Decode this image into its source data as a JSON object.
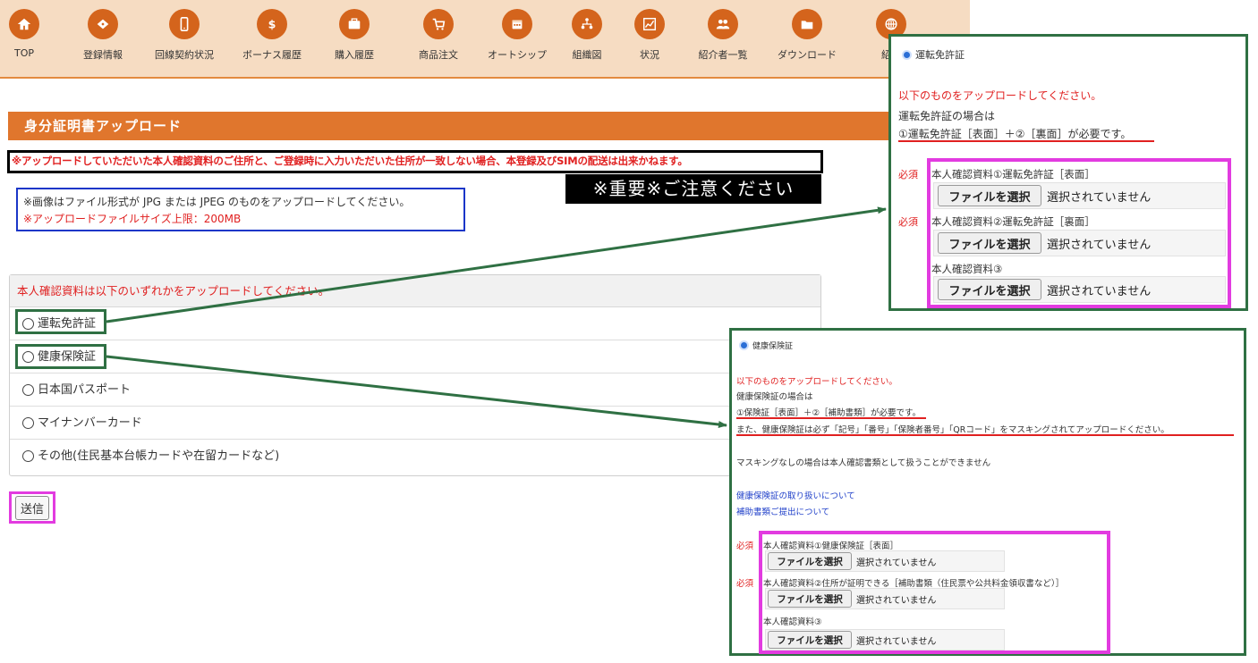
{
  "nav": {
    "items": [
      {
        "label": "TOP",
        "icon": "home-icon"
      },
      {
        "label": "登録情報",
        "icon": "tag-icon"
      },
      {
        "label": "回線契約状況",
        "icon": "phone-icon"
      },
      {
        "label": "ボーナス履歴",
        "icon": "dollar-icon"
      },
      {
        "label": "購入履歴",
        "icon": "briefcase-icon"
      },
      {
        "label": "商品注文",
        "icon": "cart-icon"
      },
      {
        "label": "オートシップ",
        "icon": "calendar-icon"
      },
      {
        "label": "組織図",
        "icon": "org-chart-icon"
      },
      {
        "label": "状況",
        "icon": "chart-icon"
      },
      {
        "label": "紹介者一覧",
        "icon": "users-icon"
      },
      {
        "label": "ダウンロード",
        "icon": "folder-icon"
      },
      {
        "label": "紹介",
        "icon": "globe-icon"
      }
    ]
  },
  "page": {
    "title": "身分証明書アップロード",
    "warning": "※アップロードしていただいた本人確認資料のご住所と、ご登録時に入力いただいた住所が一致しない場合、本登録及びSIMの配送は出来かねます。",
    "important": "※重要※ご注意ください",
    "info_format": "※画像はファイル形式が JPG または JPEG のものをアップロードしてください。",
    "info_size": "※アップロードファイルサイズ上限：200MB"
  },
  "selection": {
    "header": "本人確認資料は以下のいずれかをアップロードしてください。",
    "options": [
      "運転免許証",
      "健康保険証",
      "日本国パスポート",
      "マイナンバーカード",
      "その他(住民基本台帳カードや在留カードなど)"
    ]
  },
  "submit_label": "送信",
  "license_panel": {
    "radio_label": "運転免許証",
    "instruction": "以下のものをアップロードしてください。",
    "case_text": "運転免許証の場合は",
    "requirement": "①運転免許証［表面］＋②［裏面］が必要です。",
    "required_label": "必須",
    "file1_label": "本人確認資料①運転免許証［表面］",
    "file2_label": "本人確認資料②運転免許証［裏面］",
    "file3_label": "本人確認資料③",
    "choose_file": "ファイルを選択",
    "no_file": "選択されていません"
  },
  "insurance_panel": {
    "radio_label": "健康保険証",
    "instruction": "以下のものをアップロードしてください。",
    "case_text": "健康保険証の場合は",
    "requirement": "①保険証［表面］＋②［補助書類］が必要です。",
    "masking_note": "また、健康保険証は必ず「記号」「番号」「保険者番号」「QRコード」をマスキングされてアップロードください。",
    "no_masking_note": "マスキングなしの場合は本人確認書類として扱うことができません",
    "link1": "健康保険証の取り扱いについて",
    "link2": "補助書類ご提出について",
    "required_label": "必須",
    "file1_label": "本人確認資料①健康保険証［表面］",
    "file2_label": "本人確認資料②住所が証明できる［補助書類（住民票や公共料金領収書など）］",
    "file3_label": "本人確認資料③",
    "choose_file": "ファイルを選択",
    "no_file": "選択されていません"
  }
}
